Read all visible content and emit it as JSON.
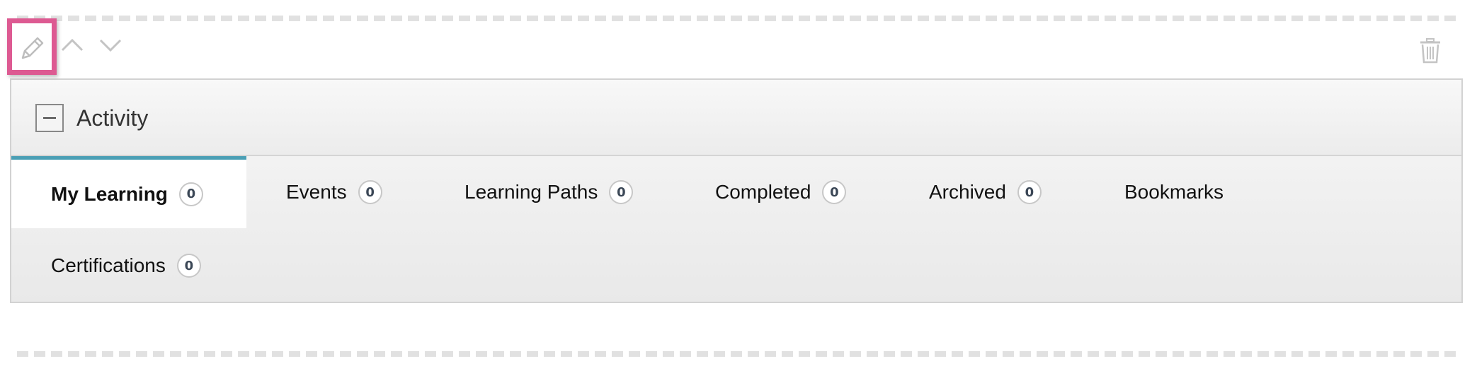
{
  "widget": {
    "title": "Activity",
    "tabs": [
      {
        "label": "My Learning",
        "count": "0"
      },
      {
        "label": "Events",
        "count": "0"
      },
      {
        "label": "Learning Paths",
        "count": "0"
      },
      {
        "label": "Completed",
        "count": "0"
      },
      {
        "label": "Archived",
        "count": "0"
      },
      {
        "label": "Bookmarks"
      },
      {
        "label": "Certifications",
        "count": "0"
      }
    ],
    "active_tab": "My Learning"
  },
  "toolbar": {
    "icons": [
      "pencil-icon",
      "chevron-up-icon",
      "chevron-down-icon",
      "trash-icon"
    ]
  },
  "colors": {
    "accent": "#4a9fb5",
    "highlight": "#dd5a92",
    "icon_gray": "#bdbdbd"
  }
}
